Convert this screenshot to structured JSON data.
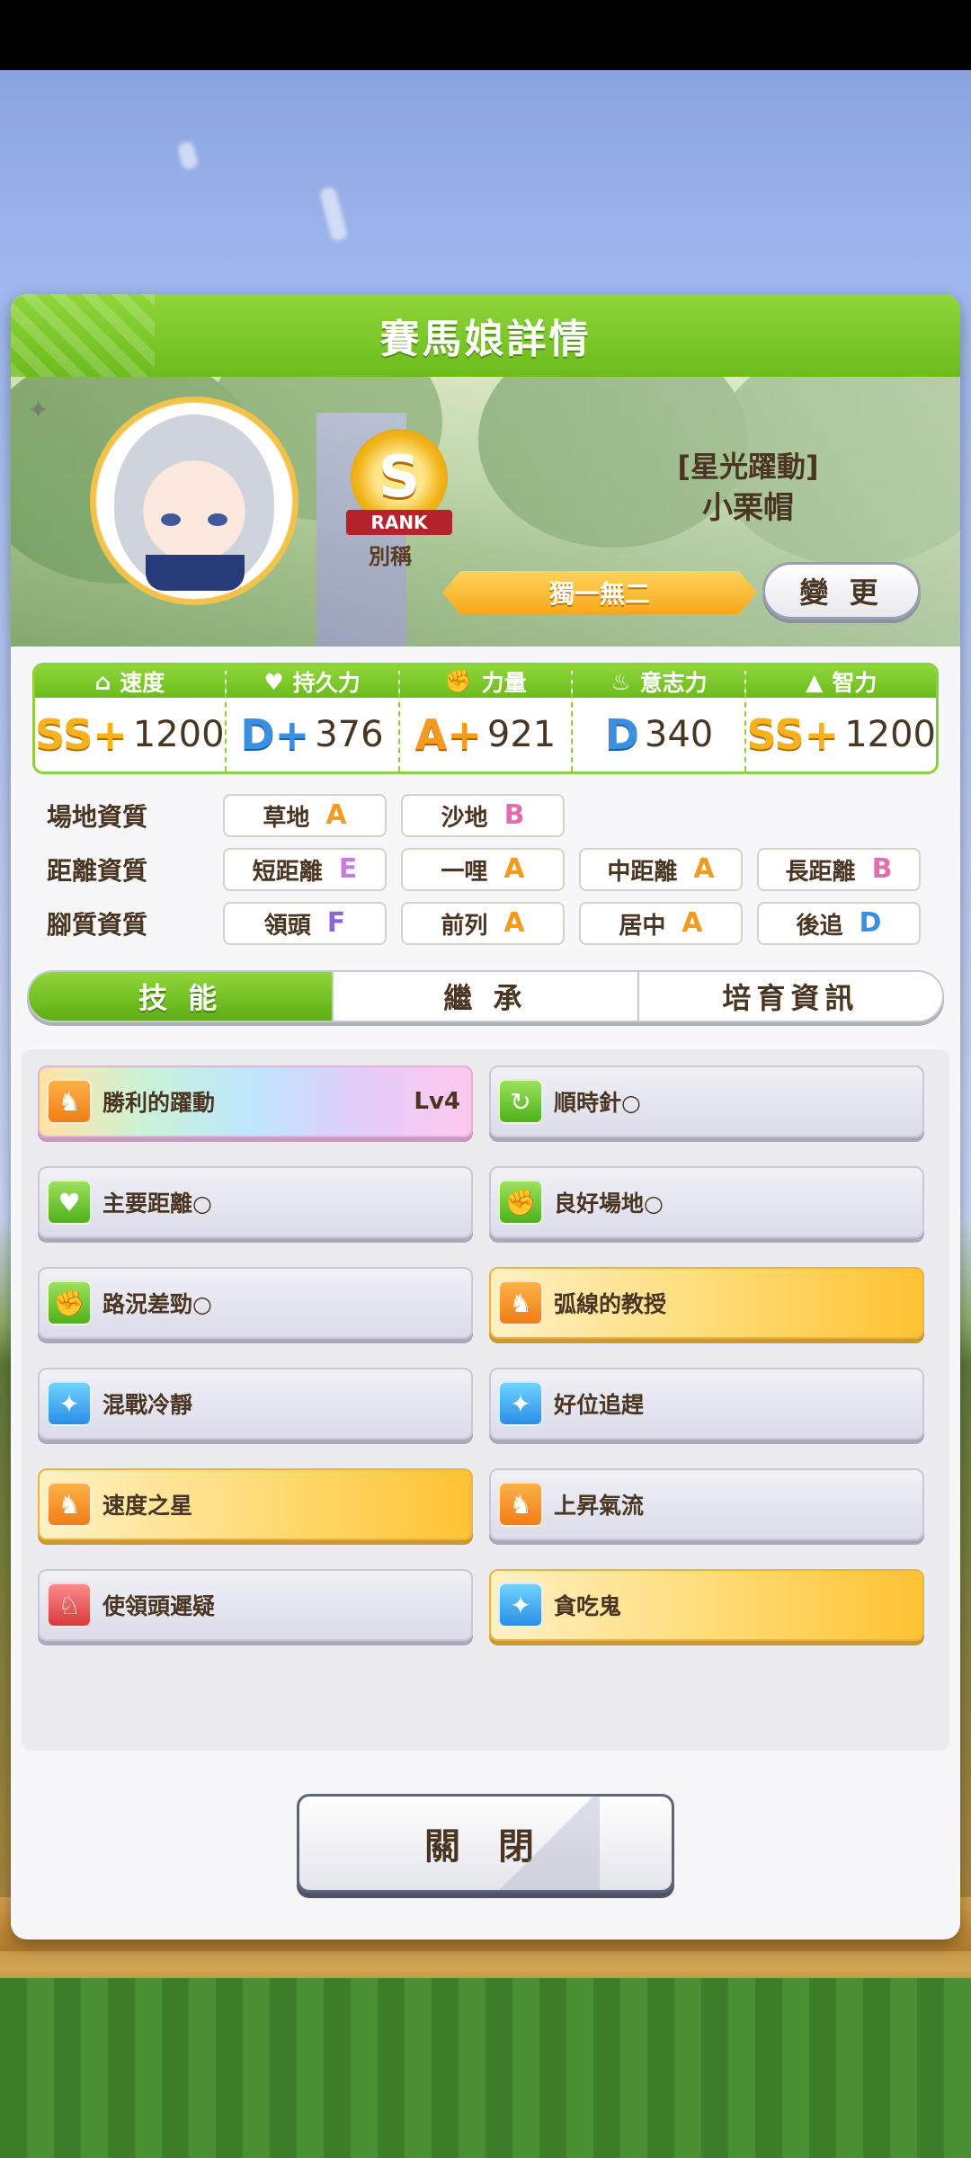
{
  "header": {
    "title": "賽馬娘詳情"
  },
  "profile": {
    "rank_letter": "S",
    "rank_ribbon": "RANK",
    "rank_caption": "別稱",
    "name_prefix": "[星光躍動]",
    "name": "小栗帽",
    "epithet": "獨一無二",
    "change_label": "變 更"
  },
  "stats": [
    {
      "label": "速度",
      "icon": "shoe-icon",
      "grade": "SS+",
      "value": "1200"
    },
    {
      "label": "持久力",
      "icon": "heart-icon",
      "grade": "D+",
      "value": "376"
    },
    {
      "label": "力量",
      "icon": "arm-icon",
      "grade": "A+",
      "value": "921"
    },
    {
      "label": "意志力",
      "icon": "flame-icon",
      "grade": "D",
      "value": "340"
    },
    {
      "label": "智力",
      "icon": "graduation-cap-icon",
      "grade": "SS+",
      "value": "1200"
    }
  ],
  "aptitudes": {
    "track": {
      "label": "場地資質",
      "items": [
        {
          "name": "草地",
          "grade": "A"
        },
        {
          "name": "沙地",
          "grade": "B"
        }
      ]
    },
    "distance": {
      "label": "距離資質",
      "items": [
        {
          "name": "短距離",
          "grade": "E"
        },
        {
          "name": "一哩",
          "grade": "A"
        },
        {
          "name": "中距離",
          "grade": "A"
        },
        {
          "name": "長距離",
          "grade": "B"
        }
      ]
    },
    "style": {
      "label": "腳質資質",
      "items": [
        {
          "name": "領頭",
          "grade": "F"
        },
        {
          "name": "前列",
          "grade": "A"
        },
        {
          "name": "居中",
          "grade": "A"
        },
        {
          "name": "後追",
          "grade": "D"
        }
      ]
    }
  },
  "tabs": [
    {
      "label": "技 能",
      "active": true
    },
    {
      "label": "繼 承",
      "active": false
    },
    {
      "label": "培育資訊",
      "active": false
    }
  ],
  "skills": [
    {
      "name": "勝利的躍動",
      "level": "Lv4",
      "style": "rainbow",
      "icon": "running-horse-icon",
      "icon_color": "orange"
    },
    {
      "name": "順時針○",
      "level": "",
      "style": "normal",
      "icon": "clockwise-icon",
      "icon_color": "green"
    },
    {
      "name": "主要距離○",
      "level": "",
      "style": "normal",
      "icon": "heart-icon",
      "icon_color": "green"
    },
    {
      "name": "良好場地○",
      "level": "",
      "style": "normal",
      "icon": "arm-icon",
      "icon_color": "green"
    },
    {
      "name": "路況差勁○",
      "level": "",
      "style": "normal",
      "icon": "arm-icon",
      "icon_color": "green"
    },
    {
      "name": "弧線的教授",
      "level": "",
      "style": "gold",
      "icon": "running-horse-icon",
      "icon_color": "orange"
    },
    {
      "name": "混戰冷靜",
      "level": "",
      "style": "normal",
      "icon": "sparkle-icon",
      "icon_color": "blue"
    },
    {
      "name": "好位追趕",
      "level": "",
      "style": "normal",
      "icon": "sparkle-icon",
      "icon_color": "blue"
    },
    {
      "name": "速度之星",
      "level": "",
      "style": "gold",
      "icon": "running-horse-icon",
      "icon_color": "orange"
    },
    {
      "name": "上昇氣流",
      "level": "",
      "style": "normal",
      "icon": "running-horse-icon",
      "icon_color": "orange"
    },
    {
      "name": "使領頭遲疑",
      "level": "",
      "style": "normal",
      "icon": "horse-debuff-icon",
      "icon_color": "red"
    },
    {
      "name": "貪吃鬼",
      "level": "",
      "style": "gold",
      "icon": "sparkle-icon",
      "icon_color": "blue"
    }
  ],
  "footer": {
    "close_label": "關 閉"
  },
  "colors": {
    "accent_green": "#6cbb1c",
    "gold": "#f6b11c",
    "text_brown": "#4a3522"
  }
}
